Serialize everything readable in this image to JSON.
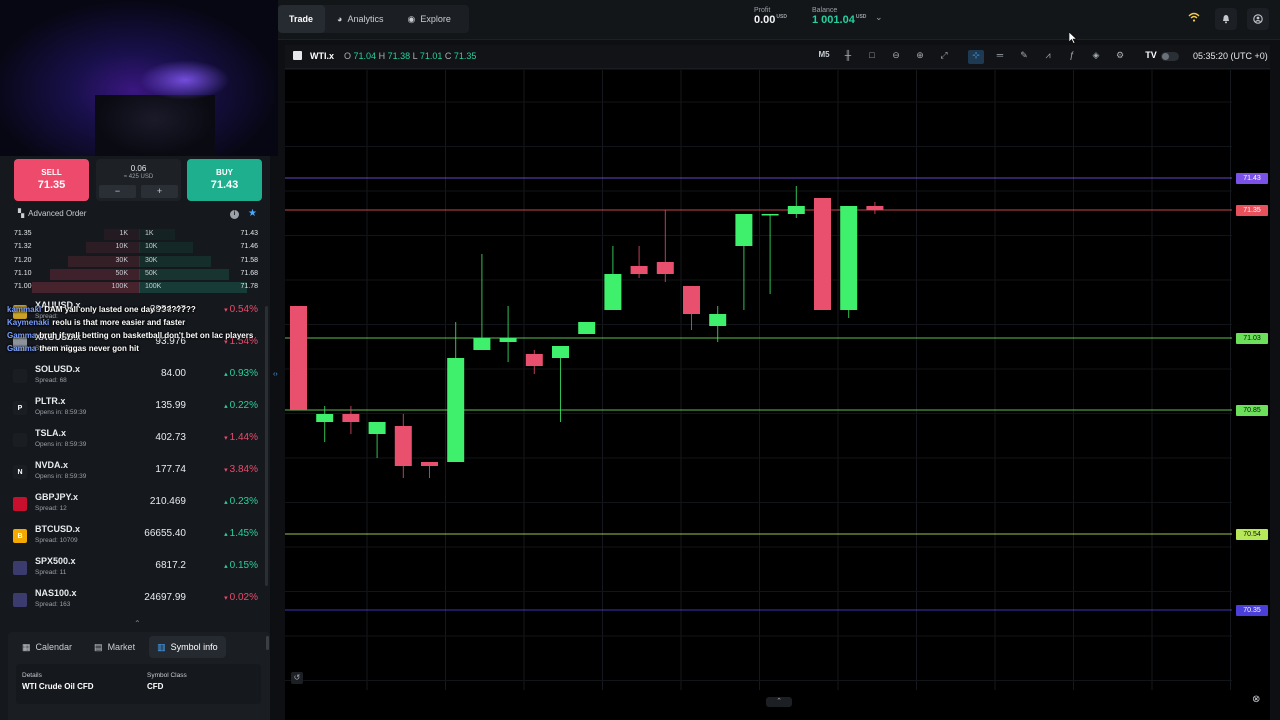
{
  "nav": {
    "tabs": [
      {
        "label": "Trade",
        "icon": "trade-icon",
        "active": true
      },
      {
        "label": "Analytics",
        "icon": "analytics-icon",
        "active": false
      },
      {
        "label": "Explore",
        "icon": "explore-icon",
        "active": false
      }
    ],
    "profit_label": "Profit",
    "profit_value": "0.00",
    "profit_currency": "USD",
    "balance_label": "Balance",
    "balance_value": "1 001.04",
    "balance_currency": "USD"
  },
  "order_panel": {
    "sell_label": "SELL",
    "sell_price": "71.35",
    "buy_label": "BUY",
    "buy_price": "71.43",
    "volume": "0.06",
    "volume_usd": "≈ 425 USD",
    "minus": "−",
    "plus": "+",
    "advanced_order_label": "Advanced Order"
  },
  "depth": [
    {
      "bid": "71.35",
      "bid_vol": "1K",
      "ask_vol": "1K",
      "ask": "71.43"
    },
    {
      "bid": "71.32",
      "bid_vol": "10K",
      "ask_vol": "10K",
      "ask": "71.46"
    },
    {
      "bid": "71.20",
      "bid_vol": "30K",
      "ask_vol": "30K",
      "ask": "71.58"
    },
    {
      "bid": "71.10",
      "bid_vol": "50K",
      "ask_vol": "50K",
      "ask": "71.68"
    },
    {
      "bid": "71.00",
      "bid_vol": "100K",
      "ask_vol": "100K",
      "ask": "71.78"
    }
  ],
  "watchlist": [
    {
      "symbol": "XAUUSD.x",
      "sub": "Spread: ",
      "price": "3954.47",
      "change": "0.54%",
      "dir": "down",
      "icon": "gold-icon",
      "icon_color": "#c9a227"
    },
    {
      "symbol": "XAGUSD.x",
      "sub": "Spread: 102",
      "price": "93.976",
      "change": "1.54%",
      "dir": "down",
      "icon": "silver-icon",
      "icon_color": "#8c939b"
    },
    {
      "symbol": "SOLUSD.x",
      "sub": "Spread: 68",
      "price": "84.00",
      "change": "0.93%",
      "dir": "up",
      "icon": "solana-icon",
      "icon_color": "#1a1d22"
    },
    {
      "symbol": "PLTR.x",
      "sub": "Opens in: 8:59:39",
      "price": "135.99",
      "change": "0.22%",
      "dir": "up",
      "icon": "palantir-icon",
      "icon_color": "#1a1d22",
      "icon_text": "P"
    },
    {
      "symbol": "TSLA.x",
      "sub": "Opens in: 8:59:39",
      "price": "402.73",
      "change": "1.44%",
      "dir": "down",
      "icon": "tesla-icon",
      "icon_color": "#1a1d22"
    },
    {
      "symbol": "NVDA.x",
      "sub": "Opens in: 8:59:39",
      "price": "177.74",
      "change": "3.84%",
      "dir": "down",
      "icon": "nvidia-icon",
      "icon_color": "#1a1d22",
      "icon_text": "N"
    },
    {
      "symbol": "GBPJPY.x",
      "sub": "Spread: 12",
      "price": "210.469",
      "change": "0.23%",
      "dir": "up",
      "icon": "gbp-flag-icon",
      "icon_color": "#c8102e"
    },
    {
      "symbol": "BTCUSD.x",
      "sub": "Spread: 10709",
      "price": "66655.40",
      "change": "1.45%",
      "dir": "up",
      "icon": "bitcoin-icon",
      "icon_color": "#f2a900",
      "icon_text": "B"
    },
    {
      "symbol": "SPX500.x",
      "sub": "Spread: 11",
      "price": "6817.2",
      "change": "0.15%",
      "dir": "up",
      "icon": "us-flag-icon",
      "icon_color": "#3c3b6e"
    },
    {
      "symbol": "NAS100.x",
      "sub": "Spread: 163",
      "price": "24697.99",
      "change": "0.02%",
      "dir": "down",
      "icon": "us-flag-icon",
      "icon_color": "#3c3b6e"
    }
  ],
  "bottom_tabs": [
    {
      "label": "Calendar",
      "icon": "calendar-icon",
      "active": false
    },
    {
      "label": "Market",
      "icon": "market-icon",
      "active": false
    },
    {
      "label": "Symbol info",
      "icon": "info-icon",
      "active": true
    }
  ],
  "symbol_info": {
    "details_label": "Details",
    "details_value": "WTI Crude Oil CFD",
    "class_label": "Symbol Class",
    "class_value": "CFD"
  },
  "chat": [
    {
      "user": "kammaki",
      "text": "DAM yall only lasted one day ????????"
    },
    {
      "user": "Kaymenaki",
      "text": "reolu is that more easier and faster"
    },
    {
      "user": "Gamma",
      "text": "bruh if yall betting on basketball don't bet on lac players"
    },
    {
      "user": "Gamma",
      "text": "them niggas never gon hit"
    }
  ],
  "chart_header": {
    "symbol": "WTI.x",
    "o_label": "O",
    "o": "71.04",
    "h_label": "H",
    "h": "71.38",
    "l_label": "L",
    "l": "71.01",
    "c_label": "C",
    "c": "71.35",
    "timeframe": "M5",
    "clock": "05:35:20 (UTC +0)"
  },
  "chart_data": {
    "type": "candlestick",
    "symbol": "WTI.x",
    "timeframe": "M5",
    "ylim": [
      70.15,
      71.7
    ],
    "candles": [
      {
        "o": 71.11,
        "h": 71.11,
        "l": 70.85,
        "c": 70.85
      },
      {
        "o": 70.82,
        "h": 70.86,
        "l": 70.77,
        "c": 70.84
      },
      {
        "o": 70.84,
        "h": 70.86,
        "l": 70.79,
        "c": 70.82
      },
      {
        "o": 70.79,
        "h": 70.82,
        "l": 70.73,
        "c": 70.82
      },
      {
        "o": 70.81,
        "h": 70.84,
        "l": 70.68,
        "c": 70.71
      },
      {
        "o": 70.72,
        "h": 70.72,
        "l": 70.68,
        "c": 70.71
      },
      {
        "o": 70.72,
        "h": 71.07,
        "l": 70.72,
        "c": 70.98
      },
      {
        "o": 71.0,
        "h": 71.24,
        "l": 71.0,
        "c": 71.03
      },
      {
        "o": 71.02,
        "h": 71.11,
        "l": 70.97,
        "c": 71.03
      },
      {
        "o": 70.99,
        "h": 71.0,
        "l": 70.94,
        "c": 70.96
      },
      {
        "o": 70.98,
        "h": 71.0,
        "l": 70.82,
        "c": 71.01
      },
      {
        "o": 71.04,
        "h": 71.06,
        "l": 71.04,
        "c": 71.07
      },
      {
        "o": 71.1,
        "h": 71.26,
        "l": 71.1,
        "c": 71.19
      },
      {
        "o": 71.21,
        "h": 71.26,
        "l": 71.18,
        "c": 71.19
      },
      {
        "o": 71.22,
        "h": 71.35,
        "l": 71.17,
        "c": 71.19
      },
      {
        "o": 71.16,
        "h": 71.16,
        "l": 71.05,
        "c": 71.09
      },
      {
        "o": 71.06,
        "h": 71.11,
        "l": 71.02,
        "c": 71.09
      },
      {
        "o": 71.26,
        "h": 71.31,
        "l": 71.1,
        "c": 71.34
      },
      {
        "o": 71.34,
        "h": 71.34,
        "l": 71.14,
        "c": 71.34
      },
      {
        "o": 71.34,
        "h": 71.41,
        "l": 71.33,
        "c": 71.36
      },
      {
        "o": 71.38,
        "h": 71.38,
        "l": 71.1,
        "c": 71.1
      },
      {
        "o": 71.1,
        "h": 71.36,
        "l": 71.08,
        "c": 71.36
      },
      {
        "o": 71.36,
        "h": 71.37,
        "l": 71.34,
        "c": 71.35
      }
    ],
    "levels": [
      {
        "price": 71.43,
        "color": "#7b52e8",
        "label": "71.43"
      },
      {
        "price": 71.35,
        "color": "#e8505b",
        "label": "71.35"
      },
      {
        "price": 71.03,
        "color": "#6ce05a",
        "label": "71.03"
      },
      {
        "price": 70.85,
        "color": "#6ce05a",
        "label": "70.85"
      },
      {
        "price": 70.54,
        "color": "#b7e85a",
        "label": "70.54"
      },
      {
        "price": 70.35,
        "color": "#4a3fd8",
        "label": "70.35"
      }
    ],
    "up_color": "#3ef06c",
    "down_color": "#e8506e"
  }
}
